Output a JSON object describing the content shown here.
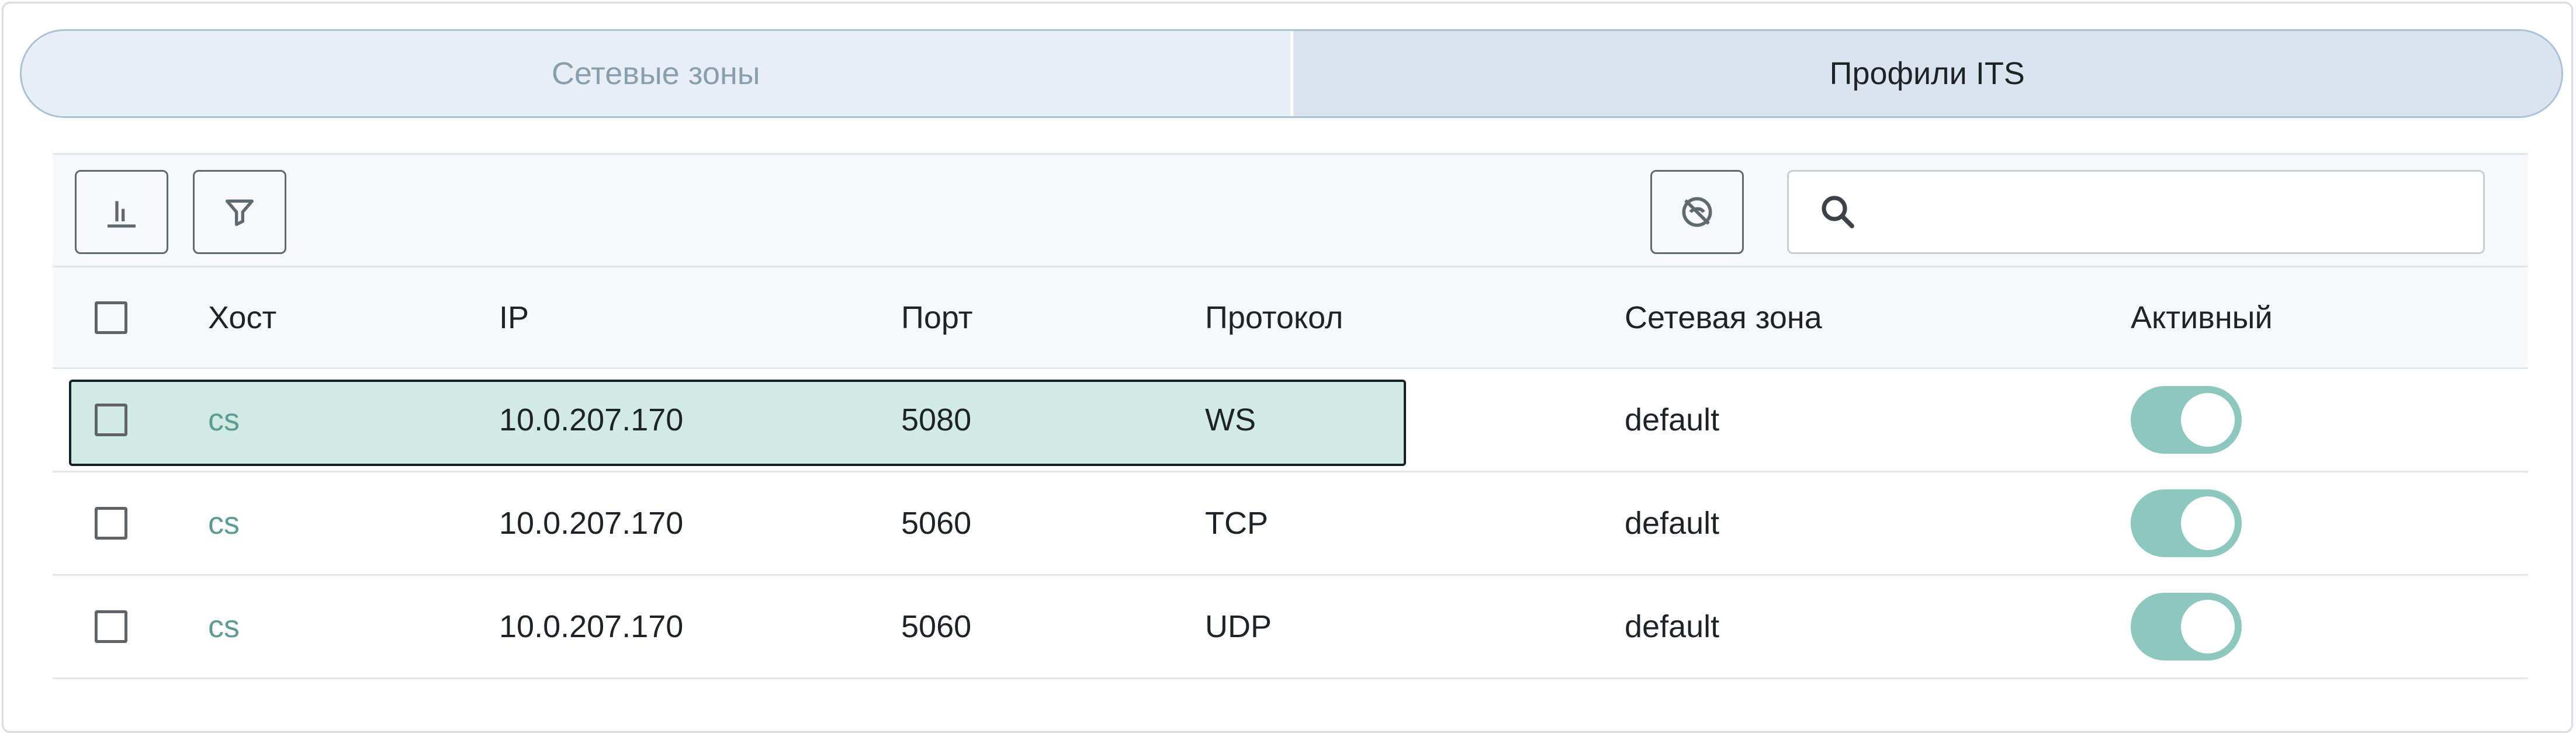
{
  "tabs": [
    {
      "label": "Сетевые зоны",
      "active": false
    },
    {
      "label": "Профили ITS",
      "active": true
    }
  ],
  "toolbar": {
    "columns_icon": "bar-chart-icon",
    "filter_icon": "filter-icon",
    "hide_icon": "eye-off-icon",
    "search_icon": "search-icon",
    "search_value": "",
    "search_placeholder": ""
  },
  "table": {
    "headers": {
      "host": "Хост",
      "ip": "IP",
      "port": "Порт",
      "protocol": "Протокол",
      "zone": "Сетевая зона",
      "active": "Активный"
    },
    "rows": [
      {
        "host": "cs",
        "ip": "10.0.207.170",
        "port": "5080",
        "protocol": "WS",
        "zone": "default",
        "active": true,
        "selected": true
      },
      {
        "host": "cs",
        "ip": "10.0.207.170",
        "port": "5060",
        "protocol": "TCP",
        "zone": "default",
        "active": true,
        "selected": false
      },
      {
        "host": "cs",
        "ip": "10.0.207.170",
        "port": "5060",
        "protocol": "UDP",
        "zone": "default",
        "active": true,
        "selected": false
      }
    ]
  },
  "colors": {
    "accent": "#5e9b94",
    "toggle_on": "#8ec7bd",
    "row_highlight": "#d1ebe4"
  }
}
